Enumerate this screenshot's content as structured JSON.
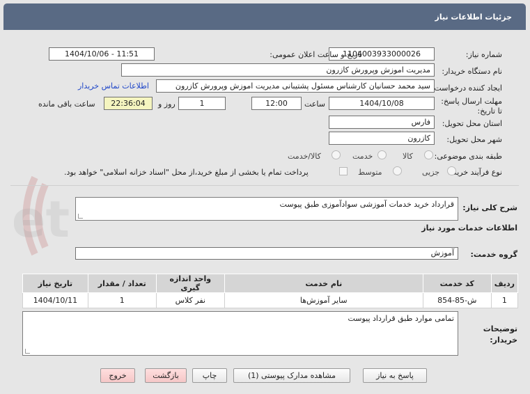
{
  "window": {
    "title": "جزئیات اطلاعات نیاز"
  },
  "form": {
    "need_number_label": "شماره نیاز:",
    "need_number": "1104003933000026",
    "announce_label": "تاریخ و ساعت اعلان عمومی:",
    "announce_value": "1404/10/06 - 11:51",
    "buyer_org_label": "نام دستگاه خریدار:",
    "buyer_org": "مدیریت اموزش وپرورش کازرون",
    "creator_label": "ایجاد کننده درخواست:",
    "creator": "سید محمد  حسانیان  کارشناس مسئول پشتیبانی مدیریت اموزش وپرورش کازرون",
    "contact_link": "اطلاعات تماس خریدار",
    "deadline_label": "مهلت ارسال پاسخ: تا تاریخ:",
    "deadline_date": "1404/10/08",
    "time_label": "ساعت",
    "deadline_time": "12:00",
    "days_value": "1",
    "days_label": "روز و",
    "remaining_time": "22:36:04",
    "remaining_label": "ساعت باقی مانده",
    "province_label": "استان محل تحویل:",
    "province": "فارس",
    "city_label": "شهر محل تحویل:",
    "city": "کازرون",
    "category_label": "طبقه بندی موضوعی:",
    "category_options": [
      "کالا",
      "خدمت",
      "کالا/خدمت"
    ],
    "process_label": "نوع فرآیند خرید :",
    "process_options": [
      "جزیی",
      "متوسط"
    ],
    "payment_note": "پرداخت تمام یا بخشی از مبلغ خرید،از محل \"اسناد خزانه اسلامی\" خواهد بود."
  },
  "summary": {
    "label": "شرح کلی نیاز:",
    "value": "قرارداد خرید خدمات آموزشی سوادآموزی  طبق پیوست"
  },
  "services": {
    "section_title": "اطلاعات خدمات مورد نیاز",
    "group_label": "گروه خدمت:",
    "group_value": "آموزش",
    "columns": [
      "ردیف",
      "کد خدمت",
      "نام خدمت",
      "واحد اندازه گیری",
      "تعداد / مقدار",
      "تاریخ نیاز"
    ],
    "rows": [
      [
        "1",
        "ش-85-854",
        "سایر آموزش‌ها",
        "نفر کلاس",
        "1",
        "1404/10/11"
      ]
    ]
  },
  "buyer_notes": {
    "label_line1": "توضیحات",
    "label_line2": "خریدار:",
    "value": "تمامی موارد طبق قرارداد پیوست"
  },
  "buttons": {
    "reply": "پاسخ به نیاز",
    "attachments": "مشاهده مدارک پیوستی (1)",
    "print": "چاپ",
    "back": "بازگشت",
    "exit": "خروج"
  },
  "watermark": {
    "text": "AriaTender.net"
  }
}
